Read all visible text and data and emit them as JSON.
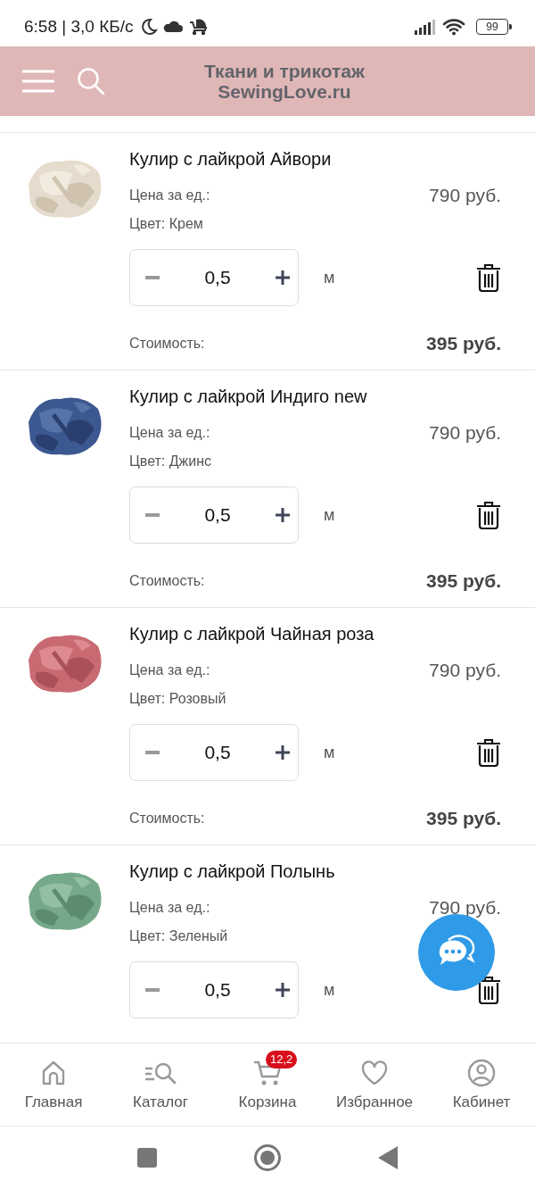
{
  "status_bar": {
    "time": "6:58 | 3,0 КБ/с",
    "battery": "99"
  },
  "header": {
    "title_line1": "Ткани и трикотаж",
    "title_line2": "SewingLove.ru"
  },
  "cart_items": [
    {
      "kind": "picture",
      "name": "Кулир с лайкрой Айвори",
      "price_label": "Цена за ед.:",
      "price": "790 руб.",
      "color_label": "Цвет: Крем",
      "quantity": "0,5",
      "unit": "м",
      "cost_label": "Стоимость:",
      "cost": "395 руб."
    },
    {
      "kind": "picture",
      "name": "Кулир с лайкрой Индиго new",
      "price_label": "Цена за ед.:",
      "price": "790 руб.",
      "color_label": "Цвет: Джинс",
      "quantity": "0,5",
      "unit": "м",
      "cost_label": "Стоимость:",
      "cost": "395 руб."
    },
    {
      "kind": "picture",
      "name": "Кулир с лайкрой Чайная роза",
      "price_label": "Цена за ед.:",
      "price": "790 руб.",
      "color_label": "Цвет: Розовый",
      "quantity": "0,5",
      "unit": "м",
      "cost_label": "Стоимость:",
      "cost": "395 руб."
    },
    {
      "kind": "picture",
      "name": "Кулир с лайкрой Полынь",
      "price_label": "Цена за ед.:",
      "price": "790 руб.",
      "color_label": "Цвет: Зеленый",
      "quantity": "0,5",
      "unit": "м"
    }
  ],
  "bottom_nav": [
    {
      "kind": "home",
      "label": "Главная"
    },
    {
      "kind": "catalog",
      "label": "Каталог"
    },
    {
      "kind": "cart",
      "label": "Корзина",
      "badge": "12,2"
    },
    {
      "kind": "favorites",
      "label": "Избранное"
    },
    {
      "kind": "account",
      "label": "Кабинет"
    }
  ]
}
